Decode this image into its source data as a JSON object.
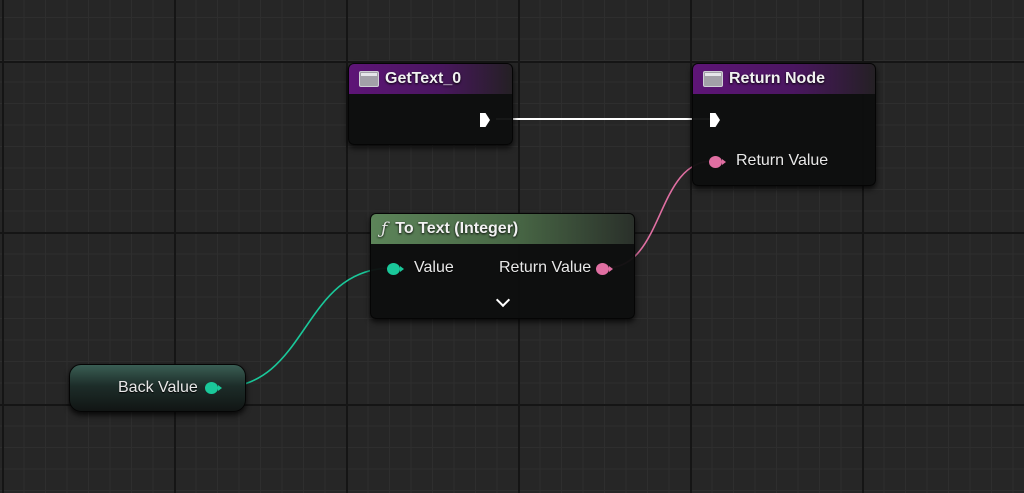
{
  "graph": {
    "get_text_node": {
      "title": "GetText_0"
    },
    "return_node": {
      "title": "Return Node",
      "return_value_label": "Return Value"
    },
    "to_text_node": {
      "function_glyph": "ƒ",
      "title": "To Text (Integer)",
      "value_label": "Value",
      "return_value_label": "Return Value"
    },
    "variable_node": {
      "label": "Back Value"
    }
  },
  "colors": {
    "canvas_background": "#262626",
    "pure_function_header": "#5c8459",
    "event_header": "#5e1577",
    "integer_pin": "#1ac89a",
    "text_pin": "#e06fa2",
    "exec_pin": "#ffffff"
  },
  "icons": {
    "node_icon": "function-window-icon",
    "pure_function_icon": "function-f-icon",
    "expand_icon": "chevron-down-icon"
  }
}
